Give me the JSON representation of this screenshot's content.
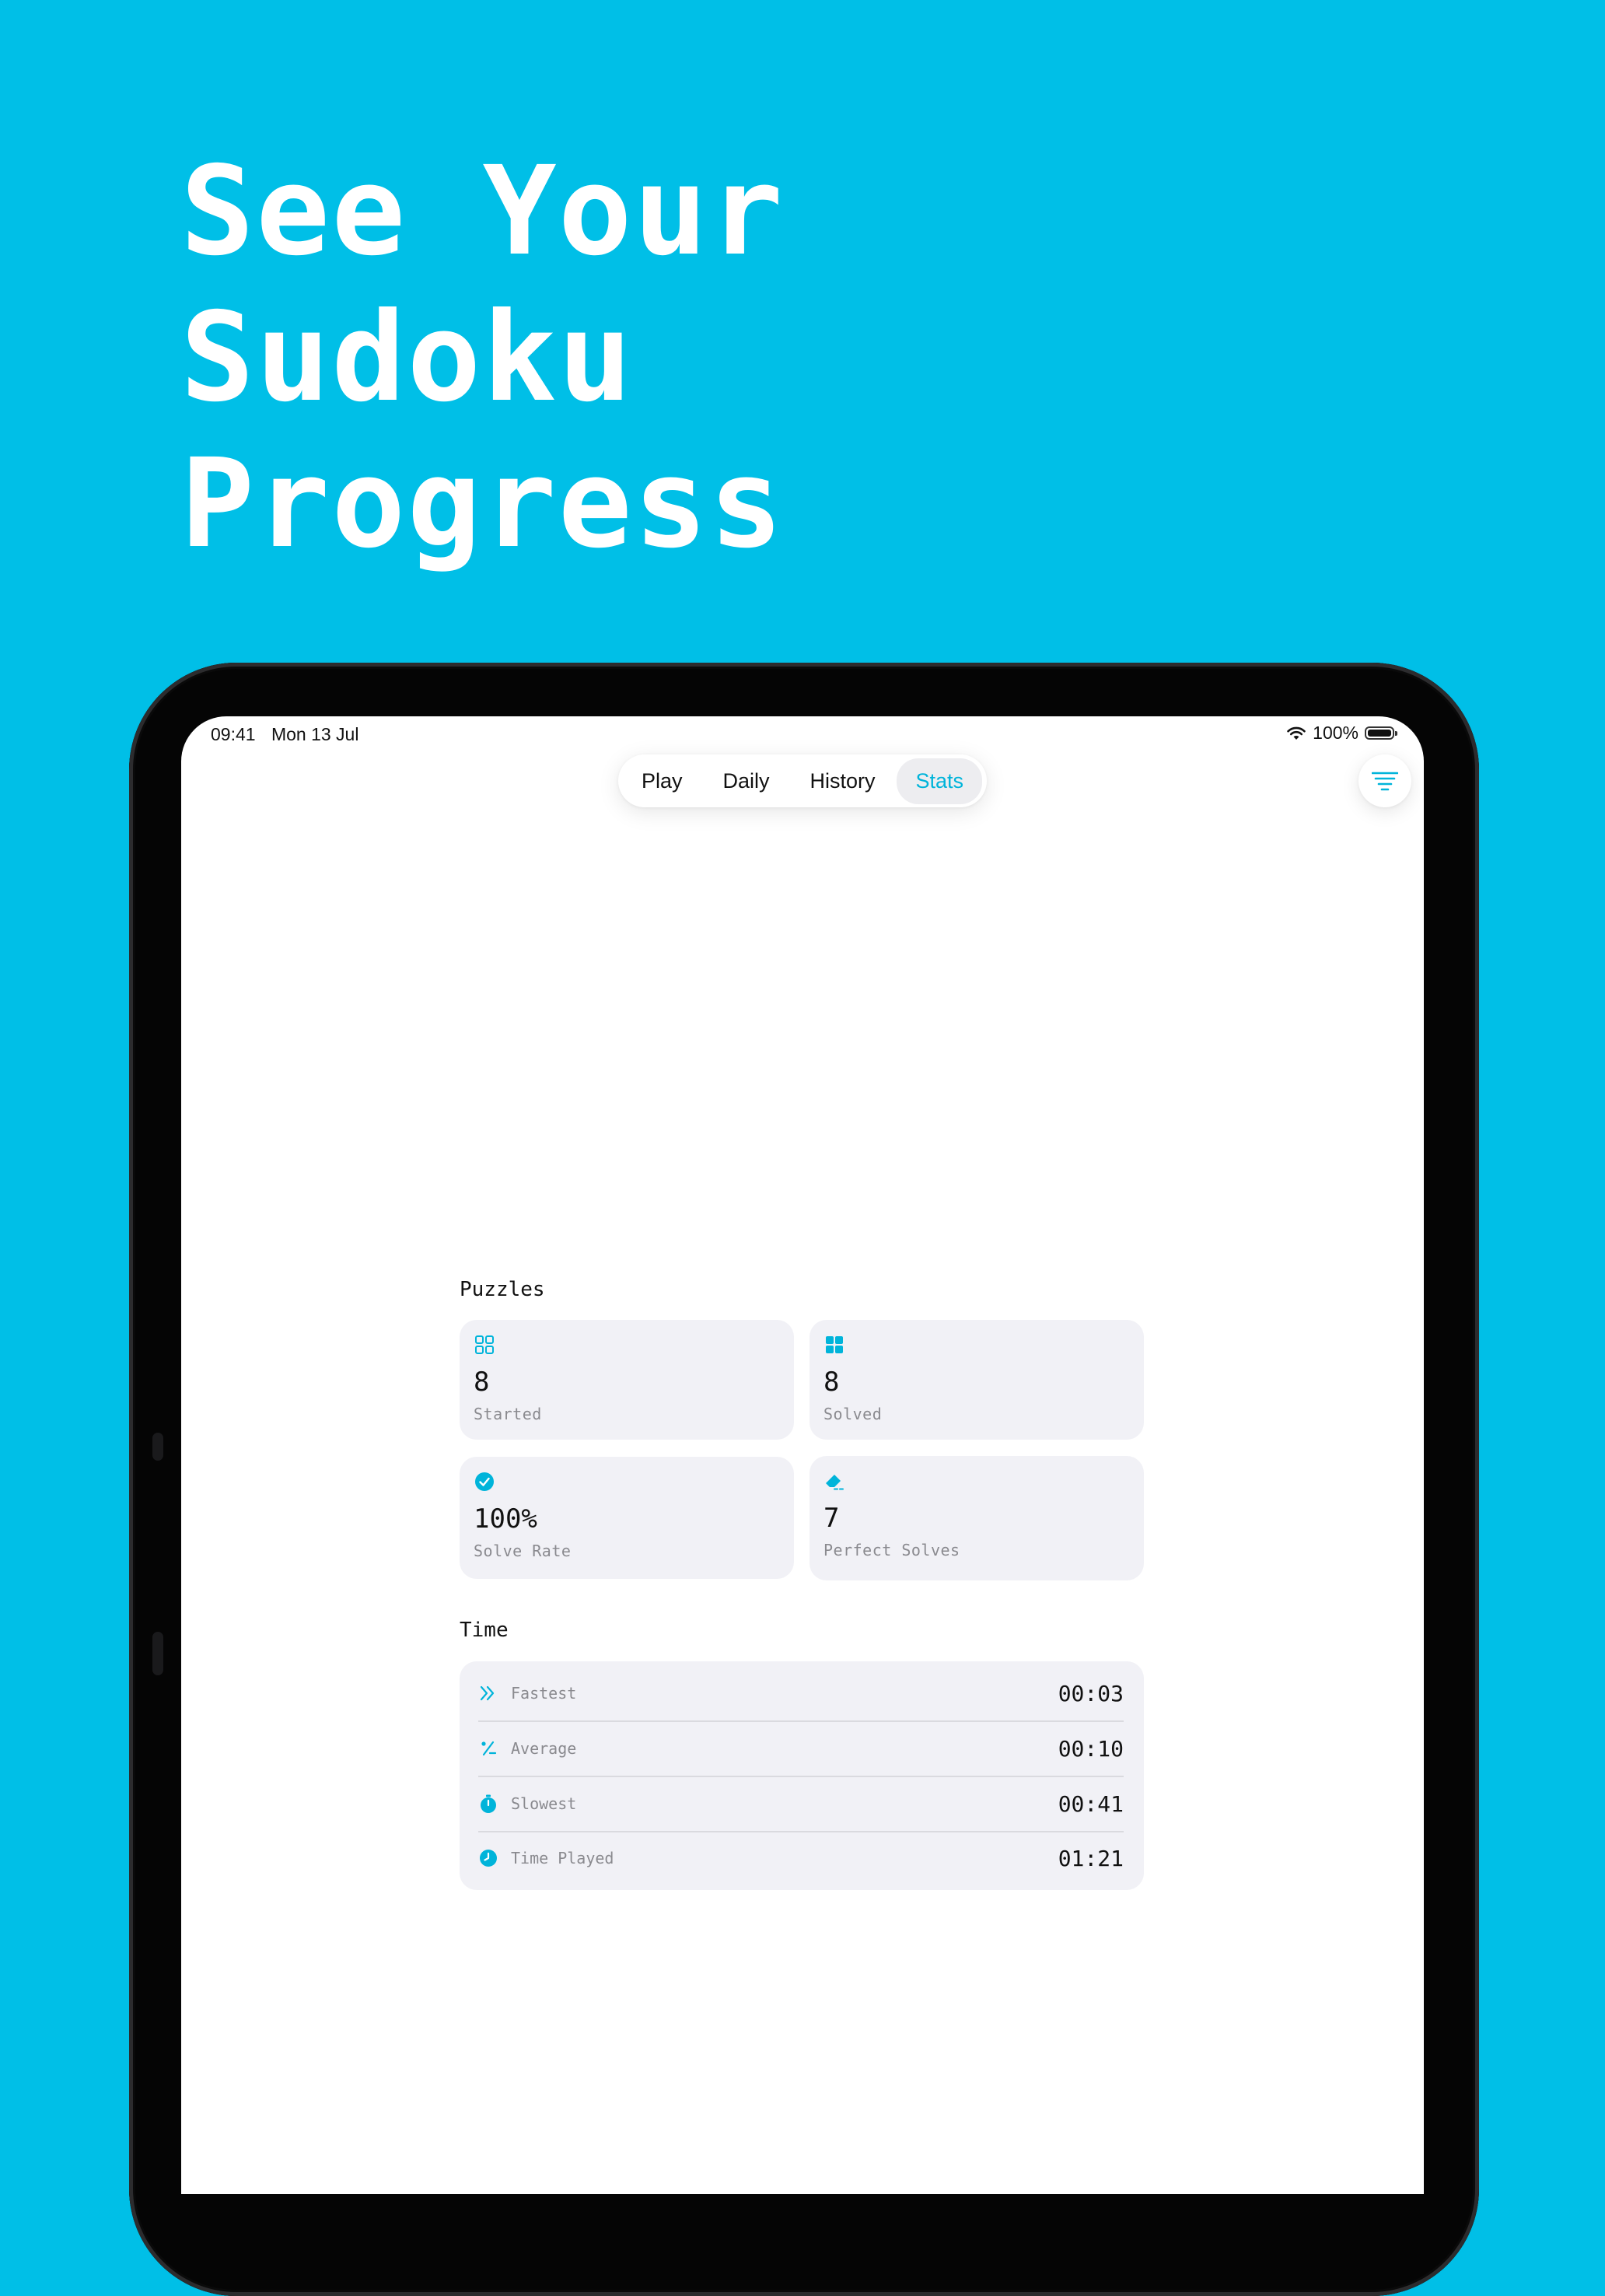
{
  "headline": {
    "line1": "See Your",
    "line2": "Sudoku",
    "line3": "Progress"
  },
  "status_bar": {
    "time": "09:41",
    "date": "Mon 13 Jul",
    "battery": "100%"
  },
  "tabs": [
    {
      "label": "Play",
      "active": false
    },
    {
      "label": "Daily",
      "active": false
    },
    {
      "label": "History",
      "active": false
    },
    {
      "label": "Stats",
      "active": true
    }
  ],
  "menu_icon": "filter-lines-icon",
  "puzzles": {
    "title": "Puzzles",
    "cards": [
      {
        "icon": "grid-outline-icon",
        "value": "8",
        "label": "Started"
      },
      {
        "icon": "grid-filled-icon",
        "value": "8",
        "label": "Solved"
      },
      {
        "icon": "checkmark-circle-icon",
        "value": "100%",
        "label": "Solve Rate"
      },
      {
        "icon": "eraser-icon",
        "value": "7",
        "label": "Perfect Solves"
      }
    ]
  },
  "time": {
    "title": "Time",
    "rows": [
      {
        "icon": "double-chevron-right-icon",
        "label": "Fastest",
        "value": "00:03"
      },
      {
        "icon": "percent-icon",
        "label": "Average",
        "value": "00:10"
      },
      {
        "icon": "stopwatch-icon",
        "label": "Slowest",
        "value": "00:41"
      },
      {
        "icon": "clock-icon",
        "label": "Time Played",
        "value": "01:21"
      }
    ]
  },
  "colors": {
    "background": "#00BFE7",
    "accent": "#00B4DA",
    "card": "#F1F1F6"
  }
}
